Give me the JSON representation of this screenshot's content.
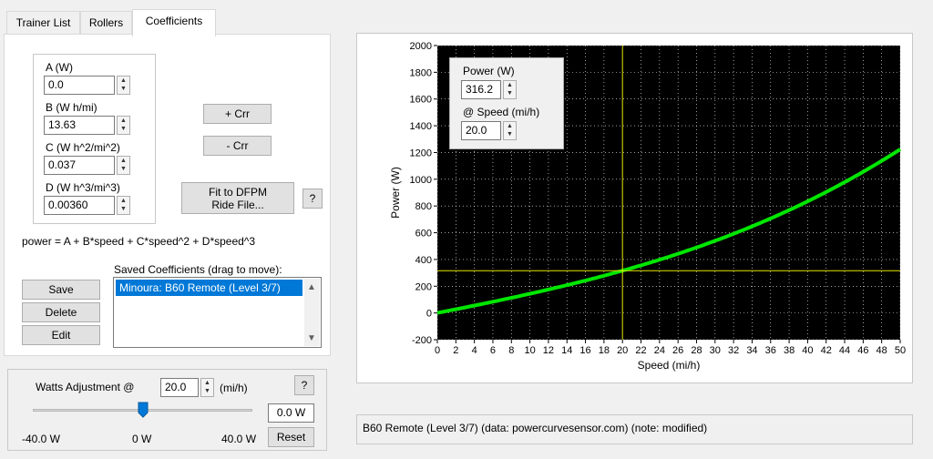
{
  "tabs": [
    {
      "label": "Trainer List"
    },
    {
      "label": "Rollers"
    },
    {
      "label": "Coefficients"
    }
  ],
  "coefficients": {
    "a_label": "A (W)",
    "a_value": "0.0",
    "b_label": "B (W h/mi)",
    "b_value": "13.63",
    "c_label": "C (W h^2/mi^2)",
    "c_value": "0.037",
    "d_label": "D (W h^3/mi^3)",
    "d_value": "0.00360",
    "formula": "power = A + B*speed + C*speed^2 + D*speed^3"
  },
  "buttons": {
    "plus_crr": "+ Crr",
    "minus_crr": "- Crr",
    "fit_line1": "Fit to DFPM",
    "fit_line2": "Ride File...",
    "help": "?",
    "save": "Save",
    "delete": "Delete",
    "edit": "Edit",
    "help2": "?",
    "reset": "Reset"
  },
  "saved": {
    "label": "Saved Coefficients (drag to move):",
    "items": [
      "Minoura: B60 Remote (Level 3/7)"
    ]
  },
  "watts": {
    "label": "Watts Adjustment @",
    "speed_value": "20.0",
    "unit": "(mi/h)",
    "output": "0.0 W",
    "min_label": "-40.0 W",
    "mid_label": "0 W",
    "max_label": "40.0 W",
    "slider_min": -40,
    "slider_max": 40,
    "slider_value": 0
  },
  "overlay": {
    "power_label": "Power (W)",
    "power_value": "316.2",
    "speed_label": "@ Speed (mi/h)",
    "speed_value": "20.0"
  },
  "status_text": "B60 Remote (Level 3/7) (data: powercurvesensor.com) (note: modified)",
  "colors": {
    "curve": "#00e600",
    "cursor": "#e6e600",
    "plot_bg": "#000000",
    "grid": "#ffffff",
    "selection": "#0078d7"
  },
  "chart_data": {
    "type": "line",
    "xlabel": "Speed (mi/h)",
    "ylabel": "Power (W)",
    "xlim": [
      0,
      50
    ],
    "ylim": [
      -200,
      2000
    ],
    "xticks": [
      0,
      2,
      4,
      6,
      8,
      10,
      12,
      14,
      16,
      18,
      20,
      22,
      24,
      26,
      28,
      30,
      32,
      34,
      36,
      38,
      40,
      42,
      44,
      46,
      48,
      50
    ],
    "yticks": [
      -200,
      0,
      200,
      400,
      600,
      800,
      1000,
      1200,
      1400,
      1600,
      1800,
      2000
    ],
    "grid": true,
    "coefficients": {
      "A": 0.0,
      "B": 13.63,
      "C": 0.037,
      "D": 0.0036
    },
    "x": [
      0,
      2,
      4,
      6,
      8,
      10,
      12,
      14,
      16,
      18,
      20,
      22,
      24,
      26,
      28,
      30,
      32,
      34,
      36,
      38,
      40,
      42,
      44,
      46,
      48,
      50
    ],
    "y": [
      0,
      27.4,
      55.3,
      83.9,
      113.3,
      143.9,
      175.9,
      209.4,
      243.9,
      284.1,
      316.2,
      375.8,
      407.2,
      461.7,
      504.8,
      572.9,
      632.7,
      689.1,
      759.6,
      830.3,
      906.8,
      989.7,
      1080.1,
      1178.5,
      1283.9,
      1189.4
    ],
    "cursor": {
      "x": 20.0,
      "y": 316.2
    }
  }
}
